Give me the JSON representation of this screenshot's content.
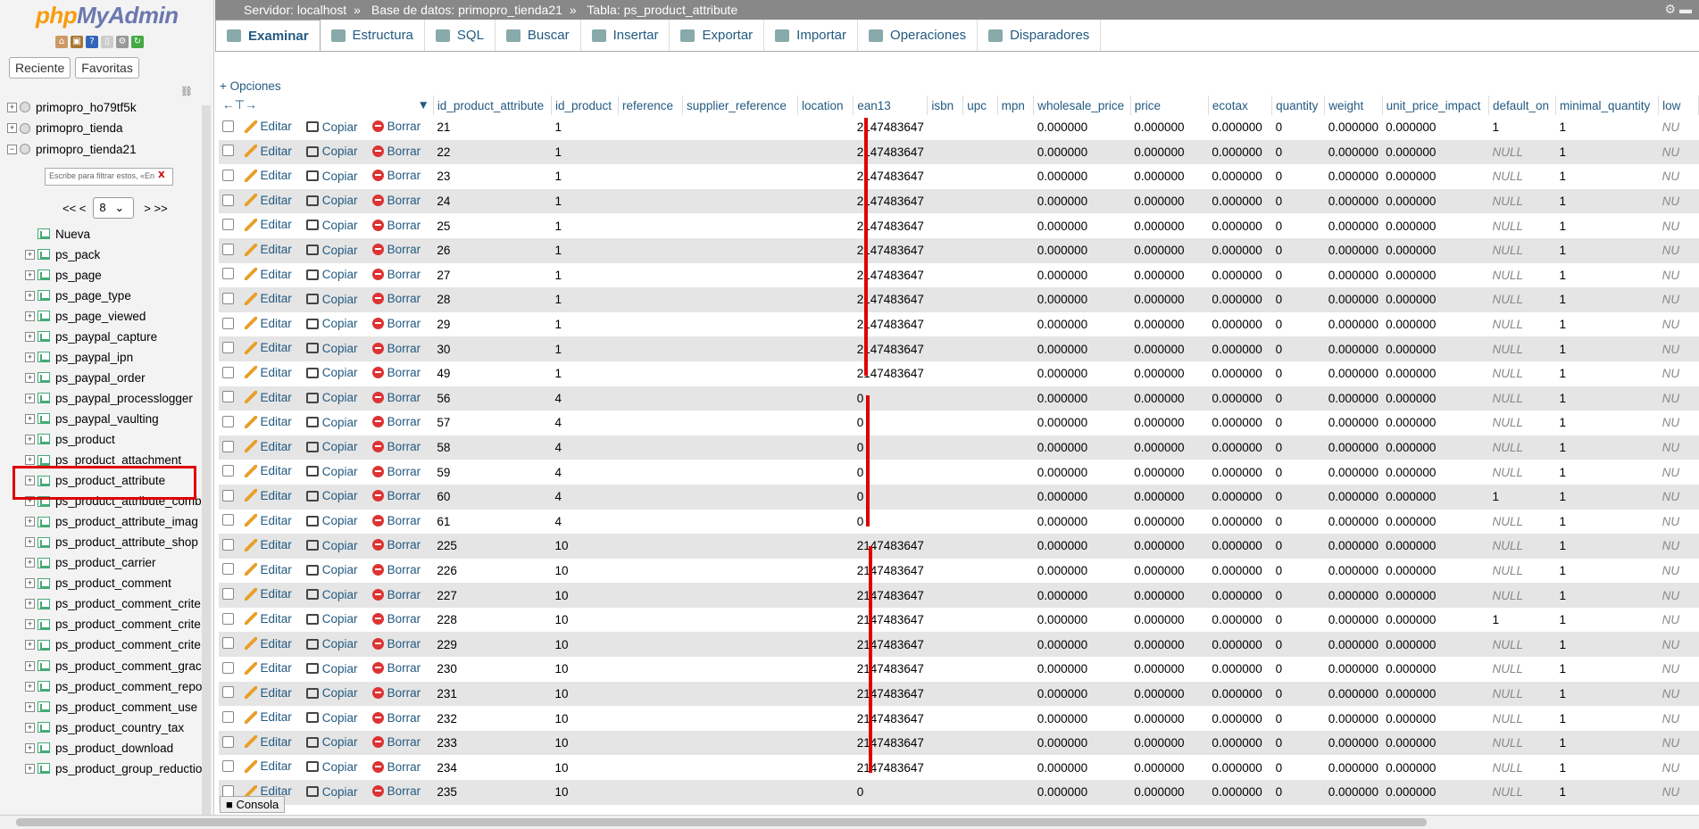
{
  "sidebar": {
    "logo_php": "php",
    "logo_name": "MyAdmin",
    "tabs": [
      "Reciente",
      "Favoritas"
    ],
    "databases": [
      "primopro_ho79tf5k",
      "primopro_tienda",
      "primopro_tienda21"
    ],
    "filter_placeholder": "Escribe para filtrar estos, «En",
    "pager_prev": "<< <",
    "pager_value": "8",
    "pager_next": "> >>",
    "new_label": "Nueva",
    "tables": [
      "ps_pack",
      "ps_page",
      "ps_page_type",
      "ps_page_viewed",
      "ps_paypal_capture",
      "ps_paypal_ipn",
      "ps_paypal_order",
      "ps_paypal_processlogger",
      "ps_paypal_vaulting",
      "ps_product",
      "ps_product_attachment",
      "ps_product_attribute",
      "ps_product_attribute_comb",
      "ps_product_attribute_imag",
      "ps_product_attribute_shop",
      "ps_product_carrier",
      "ps_product_comment",
      "ps_product_comment_crite",
      "ps_product_comment_crite",
      "ps_product_comment_crite",
      "ps_product_comment_grac",
      "ps_product_comment_repo",
      "ps_product_comment_use",
      "ps_product_country_tax",
      "ps_product_download",
      "ps_product_group_reductio"
    ]
  },
  "breadcrumb": {
    "server": "Servidor: localhost",
    "database": "Base de datos: primopro_tienda21",
    "table": "Tabla: ps_product_attribute"
  },
  "tabs": [
    "Examinar",
    "Estructura",
    "SQL",
    "Buscar",
    "Insertar",
    "Exportar",
    "Importar",
    "Operaciones",
    "Disparadores"
  ],
  "options_link": "+ Opciones",
  "actions": {
    "edit": "Editar",
    "copy": "Copiar",
    "delete": "Borrar"
  },
  "columns": [
    "id_product_attribute",
    "id_product",
    "reference",
    "supplier_reference",
    "location",
    "ean13",
    "isbn",
    "upc",
    "mpn",
    "wholesale_price",
    "price",
    "ecotax",
    "quantity",
    "weight",
    "unit_price_impact",
    "default_on",
    "minimal_quantity",
    "low"
  ],
  "rows": [
    [
      "21",
      "1",
      "2147483647",
      "1"
    ],
    [
      "22",
      "1",
      "2147483647",
      "NULL"
    ],
    [
      "23",
      "1",
      "2147483647",
      "NULL"
    ],
    [
      "24",
      "1",
      "2147483647",
      "NULL"
    ],
    [
      "25",
      "1",
      "2147483647",
      "NULL"
    ],
    [
      "26",
      "1",
      "2147483647",
      "NULL"
    ],
    [
      "27",
      "1",
      "2147483647",
      "NULL"
    ],
    [
      "28",
      "1",
      "2147483647",
      "NULL"
    ],
    [
      "29",
      "1",
      "2147483647",
      "NULL"
    ],
    [
      "30",
      "1",
      "2147483647",
      "NULL"
    ],
    [
      "49",
      "1",
      "2147483647",
      "NULL"
    ],
    [
      "56",
      "4",
      "0",
      "NULL"
    ],
    [
      "57",
      "4",
      "0",
      "NULL"
    ],
    [
      "58",
      "4",
      "0",
      "NULL"
    ],
    [
      "59",
      "4",
      "0",
      "NULL"
    ],
    [
      "60",
      "4",
      "0",
      "1"
    ],
    [
      "61",
      "4",
      "0",
      "NULL"
    ],
    [
      "225",
      "10",
      "2147483647",
      "NULL"
    ],
    [
      "226",
      "10",
      "2147483647",
      "NULL"
    ],
    [
      "227",
      "10",
      "2147483647",
      "NULL"
    ],
    [
      "228",
      "10",
      "2147483647",
      "1"
    ],
    [
      "229",
      "10",
      "2147483647",
      "NULL"
    ],
    [
      "230",
      "10",
      "2147483647",
      "NULL"
    ],
    [
      "231",
      "10",
      "2147483647",
      "NULL"
    ],
    [
      "232",
      "10",
      "2147483647",
      "NULL"
    ],
    [
      "233",
      "10",
      "2147483647",
      "NULL"
    ],
    [
      "234",
      "10",
      "2147483647",
      "NULL"
    ],
    [
      "235",
      "10",
      "0",
      "NULL"
    ]
  ],
  "zero_value": "0.000000",
  "qty_value": "0",
  "min_qty": "1",
  "low_value": "NU",
  "console_label": "Consola",
  "colors": {
    "link": "#235a81",
    "highlight": "#dd0000"
  }
}
